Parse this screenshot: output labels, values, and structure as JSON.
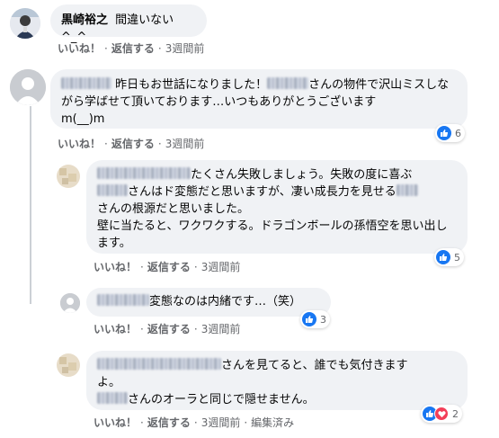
{
  "comments": [
    {
      "name": "黒崎裕之",
      "text": "間違いない^_^",
      "actions": {
        "like": "いいね！",
        "reply": "返信する",
        "time": "3週間前"
      }
    },
    {
      "text": "昨日もお世話になりました！",
      "text2": "さんの物件で沢山ミスしながら学ばせて頂いております…いつもありがとうございます",
      "text3": "m(__)m",
      "actions": {
        "like": "いいね！",
        "reply": "返信する",
        "time": "3週間前"
      },
      "reaction_count": "6"
    },
    {
      "text": "たくさん失敗しましょう。失敗の度に喜ぶ",
      "text2": "さんはド変態だと思いますが、凄い成長力を見せる",
      "text3": "さんの根源だと思いました。",
      "text4": "壁に当たると、ワクワクする。ドラゴンボールの孫悟空を思い出します。",
      "actions": {
        "like": "いいね！",
        "reply": "返信する",
        "time": "3週間前"
      },
      "reaction_count": "5"
    },
    {
      "text": "変態なのは内緒です…（笑）",
      "actions": {
        "like": "いいね！",
        "reply": "返信する",
        "time": "3週間前"
      },
      "reaction_count": "3"
    },
    {
      "text": "さんを見てると、誰でも気付きます",
      "text_b": "よ。",
      "text2": "さんのオーラと同じで隠せません。",
      "actions": {
        "like": "いいね！",
        "reply": "返信する",
        "time": "3週間前",
        "edited": "編集済み"
      },
      "reaction_count": "2"
    }
  ],
  "colors": {
    "like": "#1877f2",
    "love": "#f33e58",
    "bubble": "#f0f2f5",
    "meta": "#65676b"
  }
}
